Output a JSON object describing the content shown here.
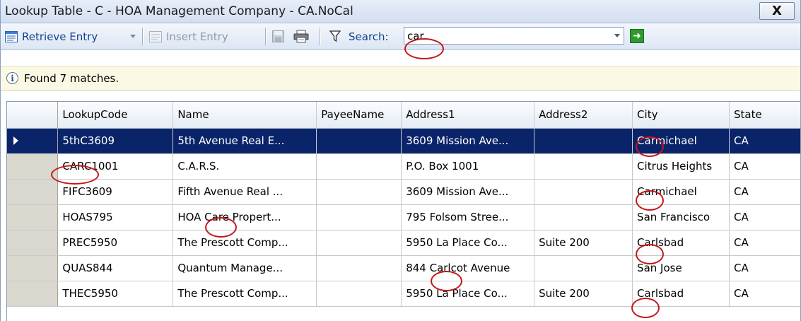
{
  "window": {
    "title": "Lookup Table - C - HOA Management Company - CA.NoCal",
    "close_label": "X"
  },
  "toolbar": {
    "retrieve_label": "Retrieve Entry",
    "insert_label": "Insert Entry",
    "search_label": "Search:",
    "search_value": "car"
  },
  "info": {
    "message": "Found 7 matches."
  },
  "grid": {
    "columns": [
      "LookupCode",
      "Name",
      "PayeeName",
      "Address1",
      "Address2",
      "City",
      "State"
    ],
    "rows": [
      {
        "lookup": "5thC3609",
        "name": "5th Avenue Real E...",
        "payee": "",
        "addr1": "3609 Mission Ave...",
        "addr2": "",
        "city": "Carmichael",
        "state": "CA",
        "selected": true
      },
      {
        "lookup": "CARC1001",
        "name": "C.A.R.S.",
        "payee": "",
        "addr1": "P.O. Box 1001",
        "addr2": "",
        "city": "Citrus Heights",
        "state": "CA"
      },
      {
        "lookup": "FIFC3609",
        "name": "Fifth Avenue Real ...",
        "payee": "",
        "addr1": "3609 Mission Ave...",
        "addr2": "",
        "city": "Carmichael",
        "state": "CA"
      },
      {
        "lookup": "HOAS795",
        "name": "HOA Care Propert...",
        "payee": "",
        "addr1": "795 Folsom Stree...",
        "addr2": "",
        "city": "San Francisco",
        "state": "CA"
      },
      {
        "lookup": "PREC5950",
        "name": "The Prescott Comp...",
        "payee": "",
        "addr1": "5950 La Place Co...",
        "addr2": "Suite 200",
        "city": "Carlsbad",
        "state": "CA"
      },
      {
        "lookup": "QUAS844",
        "name": "Quantum Manage...",
        "payee": "",
        "addr1": "844 Carlcot Avenue",
        "addr2": "",
        "city": "San Jose",
        "state": "CA"
      },
      {
        "lookup": "THEC5950",
        "name": "The Prescott Comp...",
        "payee": "",
        "addr1": "5950 La Place Co...",
        "addr2": "Suite 200",
        "city": "Carlsbad",
        "state": "CA"
      }
    ]
  },
  "colors": {
    "selected_row": "#0a246a",
    "highlight": "#c4161c",
    "info_bar": "#fbf9e4"
  }
}
